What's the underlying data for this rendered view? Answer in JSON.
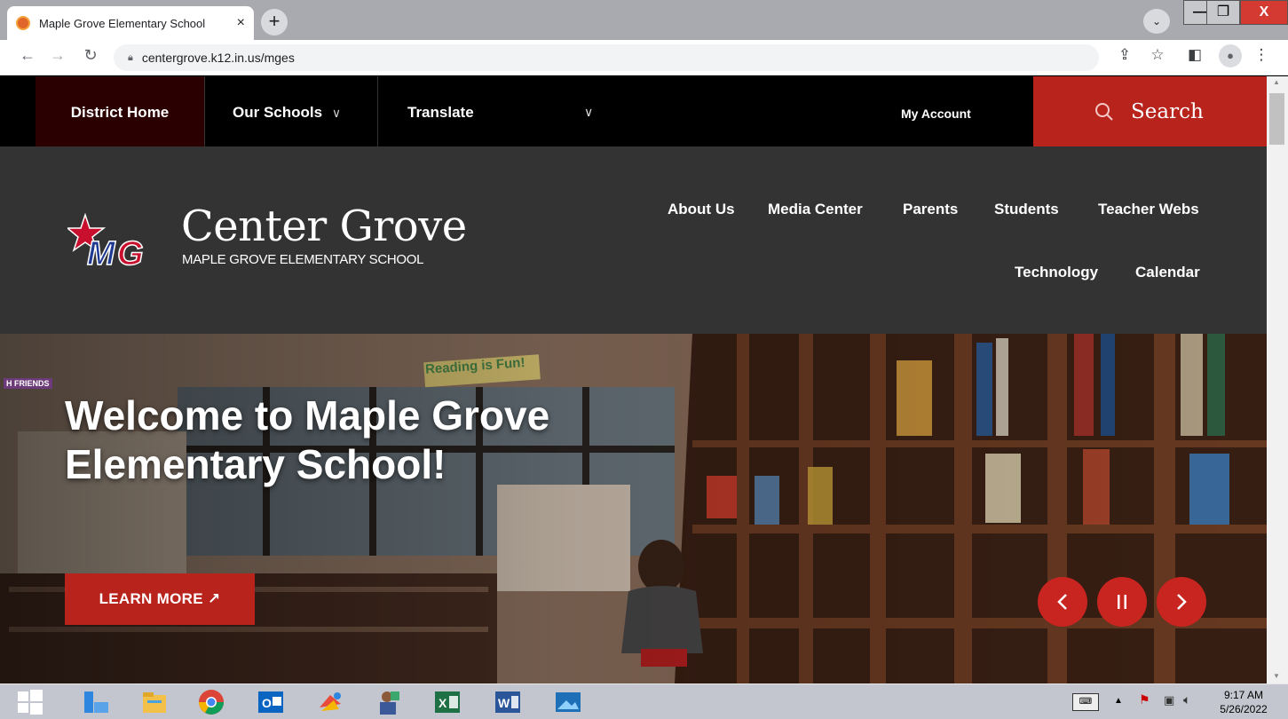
{
  "browser": {
    "tab_title": "Maple Grove Elementary School",
    "tab_close": "×",
    "new_tab": "+",
    "url": "centergrove.k12.in.us/mges",
    "min": "—",
    "max": "❐",
    "close": "X"
  },
  "topnav": {
    "district_home": "District Home",
    "our_schools": "Our Schools",
    "translate": "Translate",
    "my_account": "My Account",
    "search": "Search"
  },
  "header": {
    "brand": "Center Grove",
    "school": "MAPLE GROVE ELEMENTARY SCHOOL",
    "menu": [
      "About Us",
      "Media Center",
      "Parents",
      "Students",
      "Teacher Webs",
      "Technology",
      "Calendar"
    ]
  },
  "hero": {
    "title": "Welcome to Maple Grove Elementary School!",
    "button": "LEARN MORE ↗",
    "sign": "Reading is Fun!",
    "sign2": "H FRIENDS"
  },
  "taskbar": {
    "time": "9:17 AM",
    "date": "5/26/2022"
  },
  "colors": {
    "accent": "#b8231c",
    "nav_bg": "#000000",
    "header_bg": "#333334"
  }
}
